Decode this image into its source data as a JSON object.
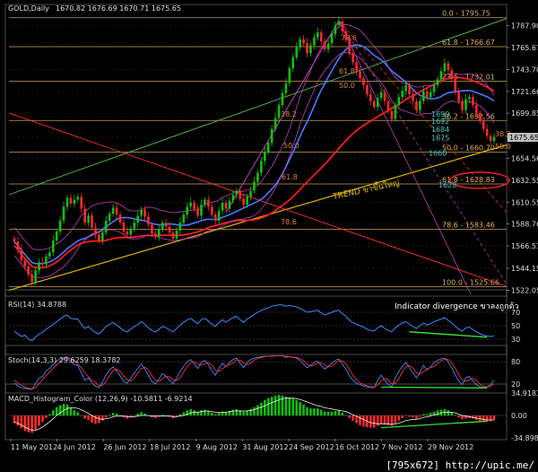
{
  "header": {
    "symbol": "GOLD,Daily",
    "ohlc": "1670.82 1676.69 1670.71 1675.65"
  },
  "watermark": "[795x672] http://upic.me/",
  "colors": {
    "background": "#000000",
    "grid": "#2a2a2a",
    "axis": "#7a7a7a",
    "bull": "#10c010",
    "bear": "#ff2a2a",
    "price_box": "#c0c0c0",
    "fib_line": "#c8a050",
    "ma_red": "#ff1a1a",
    "ma_blue": "#4a78ff",
    "bollinger": "#c040c0",
    "trend": "#e0b000",
    "rsi": "#3a8cff",
    "stoch_main": "#3a8cff",
    "stoch_signal": "#ff3030",
    "divergence": "#30e030"
  },
  "chart_data": [
    {
      "id": "price",
      "type": "candlestick",
      "y_ticks": [
        "1787.90",
        "1765.67",
        "1743.70",
        "1721.66",
        "1699.85",
        "1675.65",
        "1654.56",
        "1632.55",
        "1610.55",
        "1588.76",
        "1566.51",
        "1544.15",
        "1522.05"
      ],
      "ylim": [
        1518,
        1800
      ],
      "current_price": "1675.65",
      "fib_levels": [
        {
          "label": "0.0 - 1795.75",
          "value": 1795.75
        },
        {
          "label": "61.8 - 1766.67",
          "value": 1766.67
        },
        {
          "label": "23.6 - 1732.01",
          "value": 1732.01
        },
        {
          "label": "36.2 - 1692.56",
          "value": 1692.56
        },
        {
          "label": "50.0 - 1660.70",
          "value": 1660.7
        },
        {
          "label": "61.8 - 1628.83",
          "value": 1628.83
        },
        {
          "label": "78.6 - 1583.46",
          "value": 1583.46
        },
        {
          "label": "100.0 - 1525.66",
          "value": 1525.66
        }
      ],
      "annotations": [
        {
          "text": "1699",
          "value": 1699
        },
        {
          "text": "1692",
          "value": 1692
        },
        {
          "text": "1684",
          "value": 1684
        },
        {
          "text": "1675",
          "value": 1675
        },
        {
          "text": "1660",
          "value": 1660
        },
        {
          "text": "1628",
          "value": 1628
        }
      ],
      "inner_fib_labels": [
        "78.6",
        "61.8",
        "50.0",
        "38.2",
        "50.0",
        "61.8",
        "78.6",
        "38.2",
        "50.0"
      ],
      "trend_label": "TREND ขาขึ้นใหญ่",
      "closes": [
        1571,
        1563,
        1552,
        1546,
        1538,
        1530,
        1542,
        1550,
        1548,
        1556,
        1560,
        1572,
        1581,
        1592,
        1606,
        1615,
        1609,
        1613,
        1616,
        1604,
        1590,
        1597,
        1585,
        1578,
        1572,
        1580,
        1592,
        1599,
        1605,
        1598,
        1590,
        1581,
        1578,
        1584,
        1590,
        1597,
        1603,
        1596,
        1588,
        1579,
        1576,
        1583,
        1590,
        1586,
        1580,
        1574,
        1582,
        1590,
        1598,
        1606,
        1610,
        1604,
        1597,
        1608,
        1613,
        1606,
        1598,
        1592,
        1602,
        1610,
        1604,
        1612,
        1618,
        1622,
        1614,
        1608,
        1616,
        1622,
        1631,
        1640,
        1652,
        1661,
        1670,
        1684,
        1695,
        1708,
        1720,
        1730,
        1745,
        1756,
        1766,
        1774,
        1770,
        1760,
        1768,
        1776,
        1781,
        1772,
        1764,
        1770,
        1779,
        1788,
        1792,
        1782,
        1774,
        1760,
        1751,
        1742,
        1735,
        1728,
        1719,
        1712,
        1706,
        1715,
        1721,
        1712,
        1702,
        1694,
        1708,
        1716,
        1722,
        1728,
        1719,
        1712,
        1703,
        1712,
        1722,
        1716,
        1721,
        1728,
        1734,
        1742,
        1750,
        1743,
        1734,
        1722,
        1712,
        1703,
        1714,
        1716,
        1708,
        1700,
        1692,
        1684,
        1677,
        1672,
        1676
      ]
    },
    {
      "id": "rsi",
      "type": "line",
      "header": "RSI(14) 34.8788",
      "note": "Indicator divergence ขาลงถูกต้ว",
      "y_ticks": [
        "70",
        "50",
        "30"
      ],
      "ylim": [
        10,
        90
      ],
      "values": [
        42,
        38,
        34,
        36,
        30,
        28,
        33,
        38,
        40,
        45,
        48,
        52,
        56,
        60,
        64,
        66,
        61,
        60,
        60,
        52,
        46,
        49,
        44,
        40,
        38,
        43,
        49,
        52,
        55,
        51,
        47,
        43,
        41,
        45,
        49,
        52,
        56,
        52,
        47,
        43,
        41,
        45,
        49,
        47,
        44,
        41,
        46,
        51,
        55,
        59,
        61,
        57,
        53,
        59,
        61,
        57,
        52,
        49,
        55,
        59,
        55,
        59,
        62,
        64,
        59,
        55,
        60,
        63,
        67,
        70,
        73,
        75,
        77,
        79,
        80,
        81,
        81,
        79,
        80,
        79,
        78,
        76,
        73,
        70,
        71,
        72,
        73,
        69,
        66,
        68,
        70,
        72,
        73,
        68,
        64,
        58,
        55,
        52,
        50,
        48,
        45,
        43,
        42,
        47,
        50,
        46,
        43,
        41,
        47,
        51,
        54,
        56,
        52,
        49,
        46,
        50,
        54,
        51,
        53,
        56,
        58,
        60,
        62,
        58,
        54,
        49,
        45,
        42,
        47,
        48,
        44,
        41,
        38,
        36,
        35,
        34,
        35
      ]
    },
    {
      "id": "stoch",
      "type": "line",
      "header": "Stoch(14,3,3) 29.6259 18.3782",
      "y_ticks": [
        "80",
        "20"
      ],
      "ylim": [
        0,
        100
      ],
      "series": [
        {
          "name": "main",
          "values": [
            22,
            15,
            10,
            8,
            6,
            5,
            20,
            35,
            40,
            55,
            62,
            72,
            82,
            88,
            92,
            94,
            80,
            72,
            70,
            50,
            30,
            36,
            22,
            14,
            10,
            25,
            45,
            58,
            66,
            55,
            42,
            28,
            22,
            35,
            50,
            62,
            74,
            60,
            44,
            26,
            20,
            34,
            48,
            40,
            30,
            20,
            36,
            54,
            68,
            80,
            86,
            74,
            62,
            78,
            84,
            72,
            56,
            44,
            62,
            76,
            66,
            78,
            86,
            90,
            76,
            64,
            78,
            86,
            90,
            92,
            94,
            95,
            95,
            96,
            96,
            96,
            96,
            92,
            94,
            92,
            90,
            84,
            74,
            64,
            70,
            78,
            82,
            70,
            60,
            68,
            76,
            84,
            88,
            74,
            60,
            42,
            30,
            22,
            18,
            14,
            12,
            10,
            10,
            30,
            44,
            30,
            18,
            12,
            36,
            54,
            68,
            78,
            64,
            50,
            36,
            52,
            70,
            58,
            66,
            78,
            84,
            88,
            90,
            80,
            64,
            44,
            28,
            18,
            36,
            40,
            28,
            18,
            12,
            10,
            12,
            18,
            30
          ]
        },
        {
          "name": "signal",
          "values": [
            30,
            22,
            16,
            11,
            8,
            6,
            10,
            20,
            32,
            43,
            52,
            63,
            72,
            81,
            87,
            91,
            89,
            82,
            74,
            64,
            50,
            39,
            29,
            24,
            15,
            16,
            27,
            43,
            56,
            60,
            54,
            42,
            31,
            28,
            36,
            49,
            62,
            65,
            59,
            43,
            30,
            27,
            34,
            41,
            39,
            30,
            29,
            37,
            53,
            67,
            78,
            80,
            74,
            71,
            75,
            78,
            71,
            57,
            54,
            61,
            68,
            73,
            77,
            85,
            84,
            77,
            73,
            76,
            85,
            89,
            92,
            94,
            95,
            95,
            96,
            96,
            96,
            95,
            94,
            93,
            92,
            89,
            83,
            74,
            69,
            71,
            77,
            77,
            71,
            66,
            68,
            76,
            83,
            82,
            74,
            59,
            44,
            31,
            23,
            18,
            15,
            12,
            11,
            17,
            28,
            35,
            31,
            20,
            22,
            34,
            53,
            67,
            70,
            64,
            50,
            46,
            53,
            60,
            65,
            67,
            76,
            83,
            87,
            86,
            78,
            63,
            45,
            30,
            27,
            31,
            35,
            29,
            19,
            13,
            11,
            13,
            20
          ]
        }
      ]
    },
    {
      "id": "macd",
      "type": "histogram",
      "header": "MACD_Histogram_Color (12,26,9) -10.5811 -6.9214",
      "y_ticks": [
        "34.9181",
        "0.00",
        "-34.8989"
      ],
      "ylim": [
        -34.8989,
        34.9181
      ],
      "values": [
        -12,
        -16,
        -20,
        -24,
        -26,
        -27,
        -22,
        -16,
        -10,
        -4,
        2,
        8,
        13,
        16,
        18,
        17,
        12,
        8,
        5,
        0,
        -5,
        -7,
        -11,
        -13,
        -12,
        -8,
        -3,
        1,
        4,
        3,
        0,
        -3,
        -5,
        -3,
        0,
        3,
        5,
        3,
        0,
        -3,
        -4,
        -2,
        1,
        0,
        -2,
        -4,
        -2,
        2,
        5,
        8,
        10,
        8,
        6,
        8,
        9,
        7,
        4,
        2,
        4,
        6,
        5,
        7,
        9,
        10,
        8,
        6,
        8,
        10,
        13,
        16,
        20,
        24,
        27,
        29,
        31,
        32,
        31,
        29,
        28,
        26,
        24,
        21,
        17,
        13,
        11,
        11,
        11,
        9,
        6,
        6,
        6,
        7,
        7,
        4,
        1,
        -4,
        -8,
        -12,
        -15,
        -17,
        -18,
        -19,
        -19,
        -16,
        -13,
        -14,
        -15,
        -16,
        -12,
        -8,
        -4,
        -1,
        -2,
        -3,
        -5,
        -2,
        2,
        2,
        4,
        6,
        8,
        9,
        10,
        8,
        5,
        1,
        -3,
        -6,
        -5,
        -4,
        -5,
        -7,
        -9,
        -10,
        -10,
        -9,
        -7
      ],
      "signal_values": [
        -10,
        -12,
        -15,
        -18,
        -21,
        -23,
        -23,
        -21,
        -18,
        -14,
        -10,
        -5,
        0,
        4,
        8,
        11,
        12,
        12,
        11,
        9,
        6,
        3,
        0,
        -3,
        -5,
        -6,
        -5,
        -4,
        -2,
        -1,
        -1,
        -1,
        -2,
        -2,
        -2,
        -1,
        0,
        0,
        0,
        -1,
        -1,
        -1,
        -1,
        -1,
        -1,
        -2,
        -2,
        -1,
        0,
        2,
        4,
        5,
        5,
        6,
        7,
        7,
        6,
        5,
        5,
        5,
        5,
        6,
        7,
        7,
        7,
        7,
        7,
        8,
        9,
        11,
        13,
        15,
        18,
        20,
        22,
        24,
        26,
        27,
        27,
        27,
        26,
        25,
        23,
        21,
        19,
        17,
        15,
        14,
        12,
        11,
        10,
        9,
        8,
        7,
        6,
        4,
        1,
        -1,
        -4,
        -6,
        -9,
        -11,
        -12,
        -13,
        -13,
        -13,
        -13,
        -14,
        -13,
        -12,
        -10,
        -8,
        -7,
        -6,
        -6,
        -5,
        -3,
        -2,
        -1,
        1,
        2,
        4,
        5,
        5,
        5,
        4,
        2,
        0,
        -1,
        -2,
        -3,
        -4,
        -5,
        -6,
        -7,
        -7,
        -7
      ],
      "divergence_label": ""
    }
  ],
  "x_axis": {
    "labels": [
      "11 May 2012",
      "4 Jun 2012",
      "26 Jun 2012",
      "18 Jul 2012",
      "9 Aug 2012",
      "31 Aug 2012",
      "24 Sep 2012",
      "16 Oct 2012",
      "7 Nov 2012",
      "29 Nov 2012"
    ]
  }
}
